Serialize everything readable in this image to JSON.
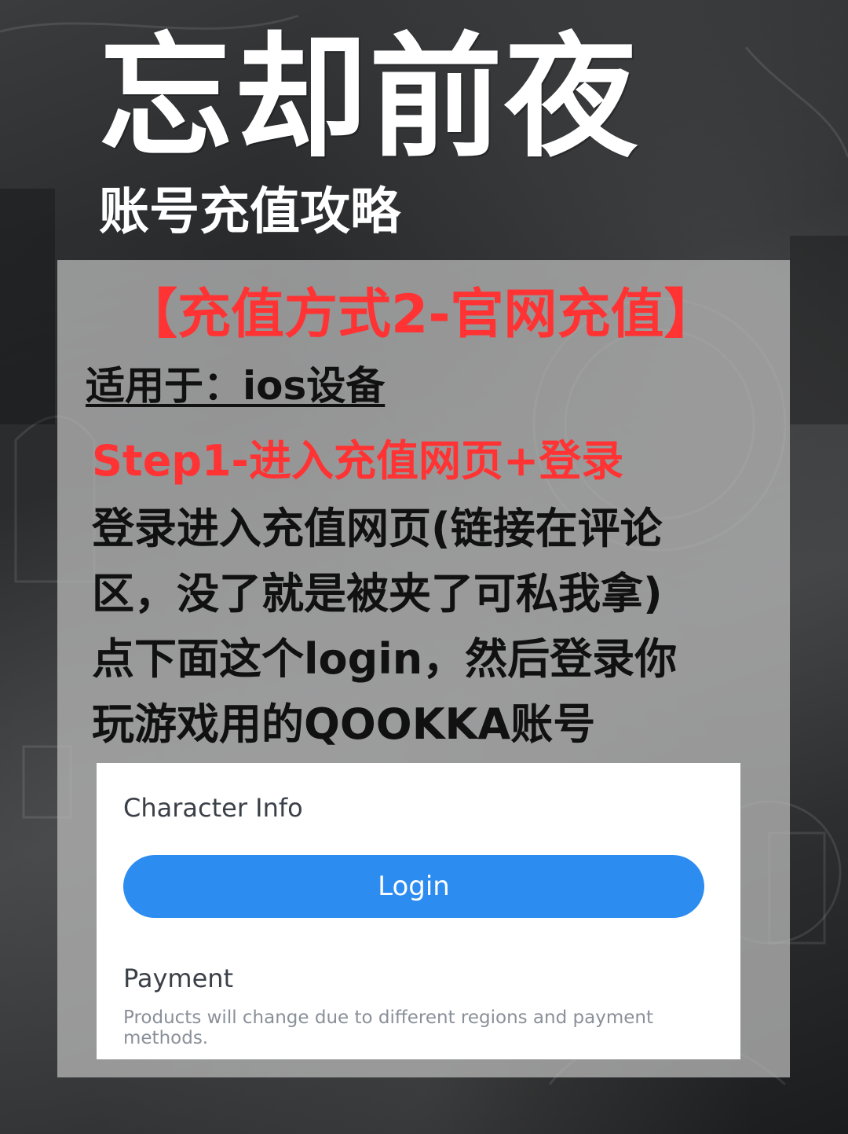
{
  "header": {
    "title": "忘却前夜",
    "subtitle": "账号充值攻略"
  },
  "panel": {
    "method_title": "【充值方式2-官网充值】",
    "applies_to": "适用于：ios设备",
    "step_title": "Step1-进入充值网页+登录",
    "instruction_lines": [
      "登录进入充值网页(链接在评论",
      "区，没了就是被夹了可私我拿)",
      "点下面这个login，然后登录你",
      "玩游戏用的QOOKKA账号"
    ]
  },
  "screenshot": {
    "character_info_label": "Character Info",
    "login_button_label": "Login",
    "payment_label": "Payment",
    "payment_note": "Products will change due to different regions and payment methods.",
    "login_button_color": "#2d8cf0"
  },
  "colors": {
    "accent_red": "#ff3333",
    "title_white": "#ffffff"
  }
}
